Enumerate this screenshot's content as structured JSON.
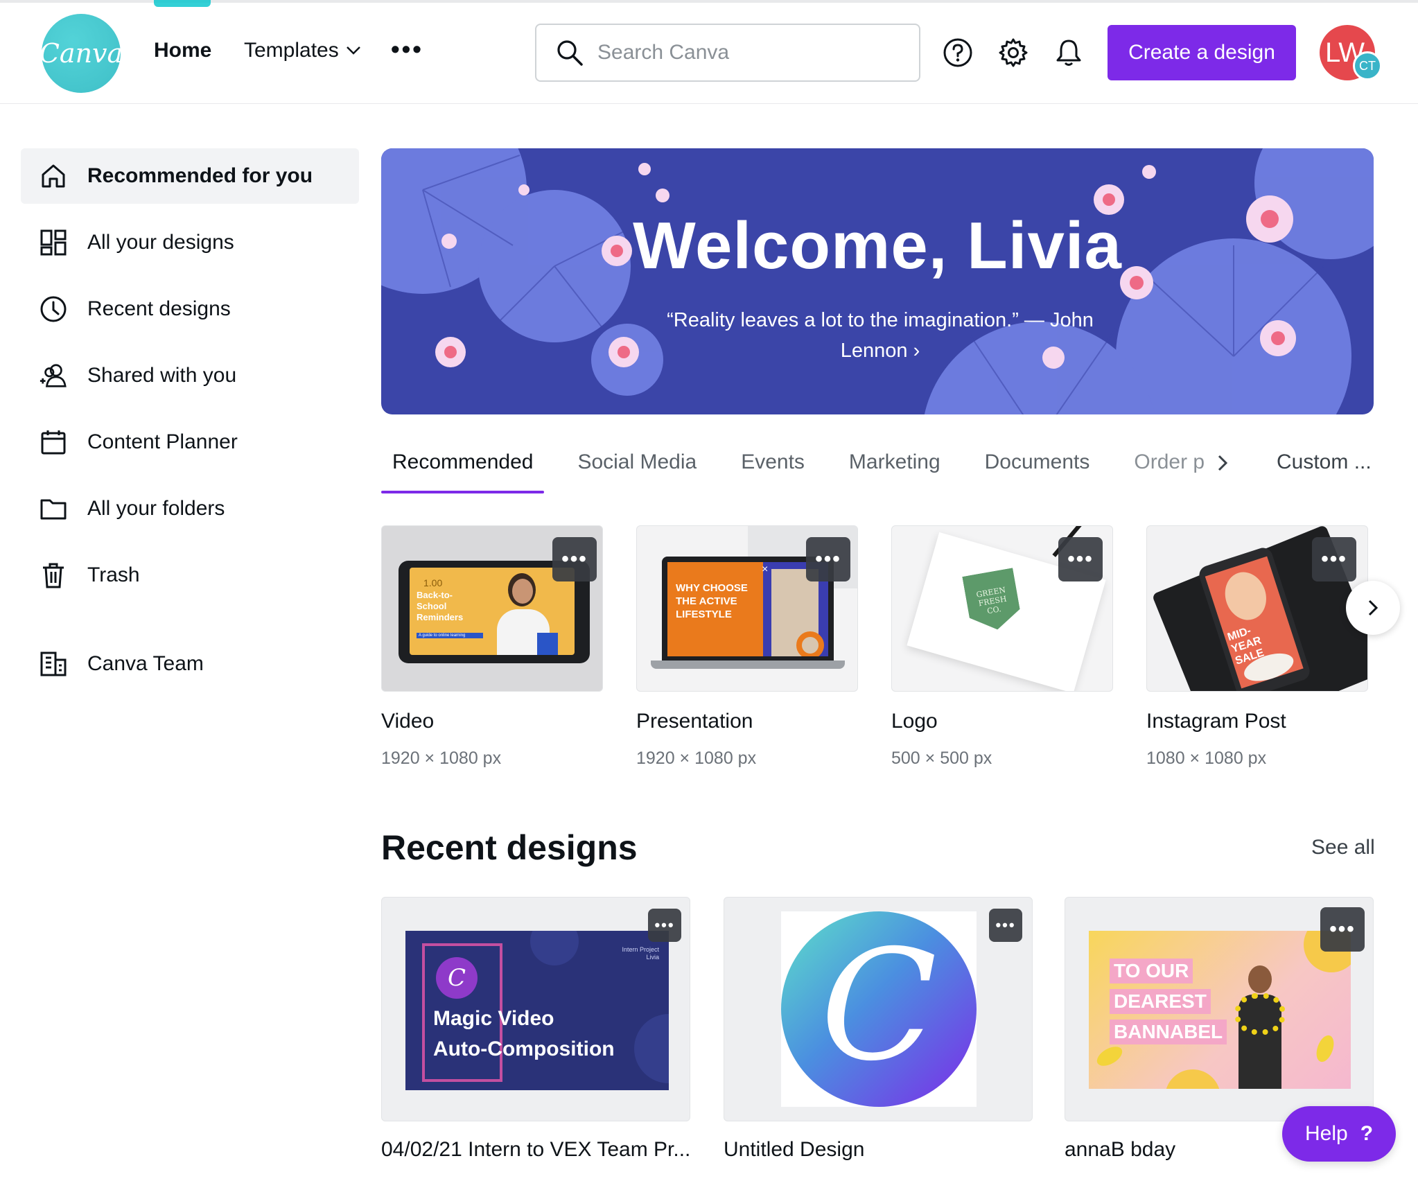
{
  "header": {
    "logo_text": "Canva",
    "nav_home": "Home",
    "nav_templates": "Templates",
    "nav_more": "•••",
    "search_placeholder": "Search Canva",
    "create_label": "Create a design",
    "avatar_initials": "LW",
    "avatar_badge": "CT"
  },
  "sidebar": {
    "items": [
      {
        "label": "Recommended for you",
        "icon": "home-icon"
      },
      {
        "label": "All your designs",
        "icon": "grid-icon"
      },
      {
        "label": "Recent designs",
        "icon": "clock-icon"
      },
      {
        "label": "Shared with you",
        "icon": "people-icon"
      },
      {
        "label": "Content Planner",
        "icon": "calendar-icon"
      },
      {
        "label": "All your folders",
        "icon": "folder-icon"
      },
      {
        "label": "Trash",
        "icon": "trash-icon"
      },
      {
        "label": "Canva Team",
        "icon": "building-icon"
      }
    ]
  },
  "banner": {
    "title": "Welcome, Livia",
    "quote": "“Reality leaves a lot to the imagination.” — John Lennon ›"
  },
  "tabs": {
    "items": [
      "Recommended",
      "Social Media",
      "Events",
      "Marketing",
      "Documents",
      "Order p"
    ],
    "custom": "Custom ..."
  },
  "templates": [
    {
      "title": "Video",
      "dims": "1920 × 1080 px",
      "thumb_text": "Back-to-School Reminders",
      "thumb_badge": "1.00",
      "thumb_caption": "A guide to online learning"
    },
    {
      "title": "Presentation",
      "dims": "1920 × 1080 px",
      "thumb_text": "WHY CHOOSE THE ACTIVE LIFESTYLE",
      "thumb_close": "×"
    },
    {
      "title": "Logo",
      "dims": "500 × 500 px",
      "thumb_text": "GREEN FRESH CO."
    },
    {
      "title": "Instagram Post",
      "dims": "1080 × 1080 px",
      "thumb_text": "MID-YEAR SALE"
    }
  ],
  "recent": {
    "title": "Recent designs",
    "see_all": "See all",
    "items": [
      {
        "title": "04/02/21 Intern to VEX Team Pr...",
        "thumb_text_1": "Magic Video",
        "thumb_text_2": "Auto-Composition",
        "thumb_corner": "Intern Project Livia",
        "thumb_logo": "C"
      },
      {
        "title": "Untitled Design",
        "thumb_logo": "C"
      },
      {
        "title": "annaB bday",
        "thumb_lines": [
          "TO OUR",
          "DEAREST",
          "BANNABEL"
        ]
      }
    ]
  },
  "help": {
    "label": "Help",
    "icon_text": "?"
  },
  "colors": {
    "accent": "#7d2ae8",
    "brand": "#00c4cc",
    "banner_bg": "#3b45a8"
  }
}
